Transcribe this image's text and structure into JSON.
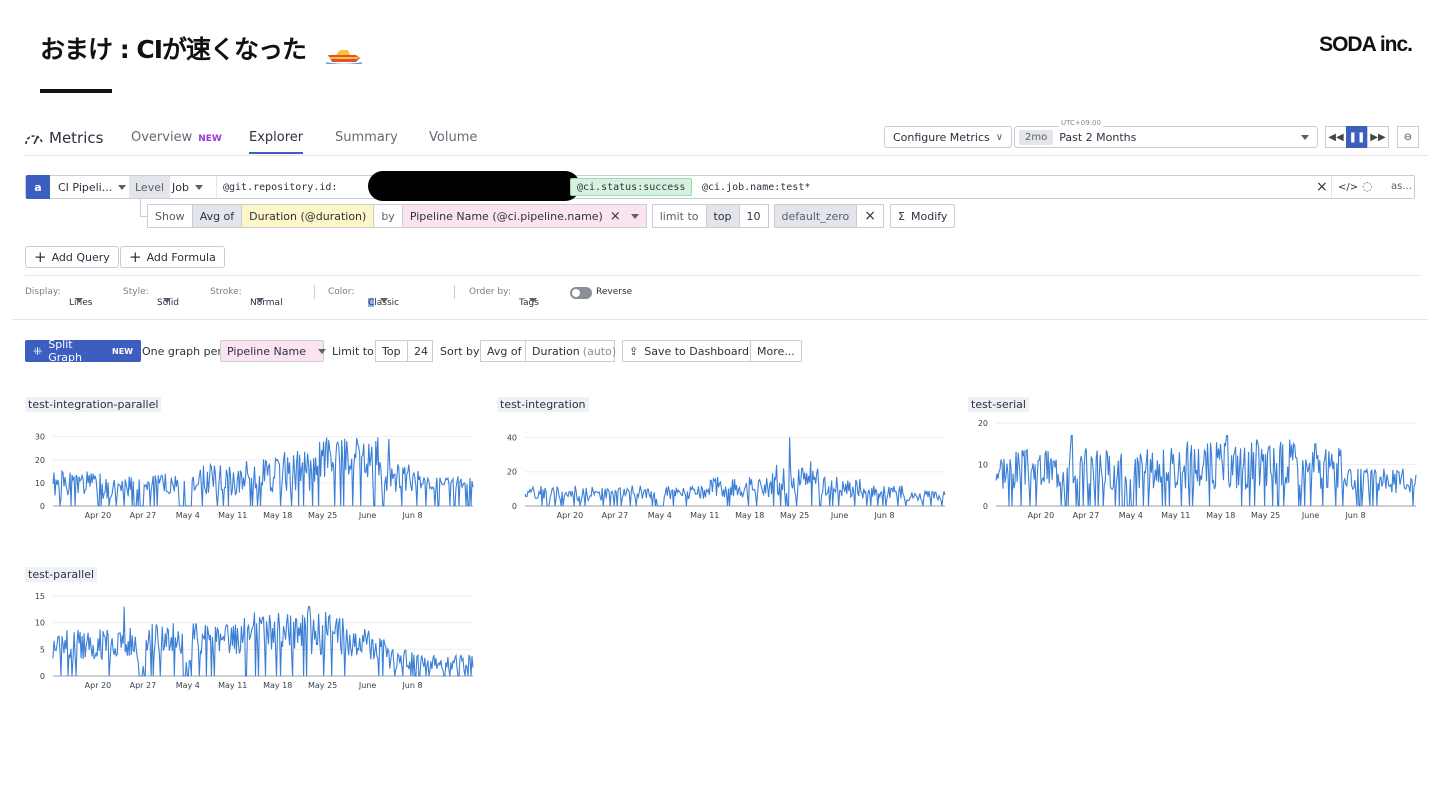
{
  "slide": {
    "title": "おまけ : CIが速くなった",
    "brand": "SODA inc.",
    "emoji_icon": "speedboat-icon"
  },
  "nav": {
    "product": "Metrics",
    "tabs": [
      {
        "label": "Overview",
        "badge": "NEW"
      },
      {
        "label": "Explorer",
        "active": true
      },
      {
        "label": "Summary"
      },
      {
        "label": "Volume"
      }
    ],
    "configure": "Configure Metrics",
    "timezone": "UTC+09:00",
    "range_pill": "2mo",
    "range_label": "Past 2 Months"
  },
  "query": {
    "letter": "a",
    "source": "CI Pipeli...",
    "level_label": "Level",
    "level_value": "Job",
    "filter_repo": "@git.repository.id:",
    "filter_status": "@ci.status:success",
    "filter_job": "@ci.job.name:test*",
    "alias": "as...",
    "show": "Show",
    "aggregation": "Avg of",
    "measure": "Duration (@duration)",
    "by": "by",
    "group": "Pipeline Name (@ci.pipeline.name)",
    "limit_label": "limit to",
    "limit_dir": "top",
    "limit_n": "10",
    "fill": "default_zero",
    "modify": "Modify"
  },
  "actions": {
    "add_query": "Add Query",
    "add_formula": "Add Formula"
  },
  "display": {
    "display_label": "Display:",
    "display_value": "Lines",
    "style_label": "Style:",
    "style_value": "Solid",
    "stroke_label": "Stroke:",
    "stroke_value": "Normal",
    "color_label": "Color:",
    "color_value": "Classic",
    "order_label": "Order by:",
    "order_value": "Tags",
    "reverse_label": "Reverse"
  },
  "split": {
    "button": "Split Graph",
    "badge": "NEW",
    "one_per": "One graph per",
    "per_value": "Pipeline Name",
    "limit_label": "Limit to",
    "limit_dir": "Top",
    "limit_n": "24",
    "sort_label": "Sort by",
    "sort_agg": "Avg of",
    "sort_measure": "Duration",
    "sort_hint": "(auto)",
    "save": "Save to Dashboard",
    "more": "More..."
  },
  "colors": {
    "accent": "#3c5fbf",
    "series": "#3a7fd5"
  },
  "chart_data": [
    {
      "type": "line",
      "title": "test-integration-parallel",
      "x_ticks": [
        "Apr 20",
        "Apr 27",
        "May 4",
        "May 11",
        "May 18",
        "May 25",
        "June",
        "Jun 8"
      ],
      "y_ticks": [
        0,
        10,
        20,
        30
      ],
      "ylim": [
        0,
        32
      ],
      "seed": 1,
      "segments": [
        [
          0.0,
          0.12,
          9,
          6
        ],
        [
          0.12,
          0.19,
          8,
          5
        ],
        [
          0.22,
          0.3,
          9,
          5
        ],
        [
          0.33,
          0.45,
          11,
          7
        ],
        [
          0.45,
          0.55,
          13,
          8
        ],
        [
          0.55,
          0.63,
          15,
          9
        ],
        [
          0.63,
          0.78,
          20,
          10
        ],
        [
          0.78,
          0.87,
          12,
          6
        ],
        [
          0.87,
          1.0,
          10,
          3
        ]
      ],
      "gaps": [
        [
          0.19,
          0.22
        ],
        [
          0.3,
          0.33
        ]
      ],
      "peaks": [
        [
          0.7,
          28
        ],
        [
          0.74,
          27
        ],
        [
          0.8,
          29
        ],
        [
          0.68,
          26
        ]
      ]
    },
    {
      "type": "line",
      "title": "test-integration",
      "x_ticks": [
        "Apr 20",
        "Apr 27",
        "May 4",
        "May 11",
        "May 18",
        "May 25",
        "June",
        "Jun 8"
      ],
      "y_ticks": [
        0,
        20,
        40
      ],
      "ylim": [
        0,
        42
      ],
      "seed": 2,
      "segments": [
        [
          0.0,
          0.12,
          8,
          4
        ],
        [
          0.12,
          0.2,
          7,
          4
        ],
        [
          0.22,
          0.31,
          8,
          4
        ],
        [
          0.33,
          0.44,
          8,
          4
        ],
        [
          0.44,
          0.58,
          11,
          6
        ],
        [
          0.58,
          0.7,
          14,
          8
        ],
        [
          0.7,
          0.8,
          11,
          6
        ],
        [
          0.8,
          0.9,
          8,
          4
        ],
        [
          0.9,
          1.0,
          6,
          3
        ]
      ],
      "gaps": [
        [
          0.2,
          0.22
        ],
        [
          0.31,
          0.33
        ]
      ],
      "peaks": [
        [
          0.63,
          40
        ],
        [
          0.68,
          26
        ],
        [
          0.6,
          24
        ],
        [
          0.66,
          22
        ]
      ]
    },
    {
      "type": "line",
      "title": "test-serial",
      "x_ticks": [
        "Apr 20",
        "Apr 27",
        "May 4",
        "May 11",
        "May 18",
        "May 25",
        "June",
        "Jun 8"
      ],
      "y_ticks": [
        0,
        10,
        20
      ],
      "ylim": [
        0,
        20
      ],
      "seed": 3,
      "segments": [
        [
          0.0,
          0.18,
          9,
          5
        ],
        [
          0.2,
          0.3,
          9,
          5
        ],
        [
          0.33,
          0.45,
          9,
          5
        ],
        [
          0.45,
          0.6,
          10,
          6
        ],
        [
          0.6,
          0.72,
          10,
          6
        ],
        [
          0.72,
          0.84,
          9,
          5
        ],
        [
          0.84,
          1.0,
          6,
          3
        ]
      ],
      "gaps": [
        [
          0.18,
          0.2
        ],
        [
          0.3,
          0.33
        ]
      ],
      "peaks": [
        [
          0.18,
          17
        ],
        [
          0.55,
          17
        ],
        [
          0.62,
          16
        ],
        [
          0.7,
          16
        ],
        [
          0.76,
          15
        ]
      ]
    },
    {
      "type": "line",
      "title": "test-parallel",
      "x_ticks": [
        "Apr 20",
        "Apr 27",
        "May 4",
        "May 11",
        "May 18",
        "May 25",
        "June",
        "Jun 8"
      ],
      "y_ticks": [
        0,
        5,
        10,
        15
      ],
      "ylim": [
        0,
        15
      ],
      "seed": 4,
      "segments": [
        [
          0.0,
          0.12,
          6,
          3
        ],
        [
          0.12,
          0.2,
          6,
          3
        ],
        [
          0.22,
          0.31,
          7,
          3
        ],
        [
          0.33,
          0.45,
          7,
          3
        ],
        [
          0.45,
          0.56,
          8,
          4
        ],
        [
          0.56,
          0.7,
          8,
          4
        ],
        [
          0.7,
          0.8,
          6,
          3
        ],
        [
          0.8,
          0.88,
          3,
          2
        ],
        [
          0.88,
          1.0,
          2.5,
          1.5
        ]
      ],
      "gaps": [
        [
          0.2,
          0.22
        ],
        [
          0.31,
          0.33
        ]
      ],
      "peaks": [
        [
          0.17,
          13
        ],
        [
          0.61,
          13
        ],
        [
          0.65,
          12
        ],
        [
          0.5,
          11
        ]
      ]
    }
  ]
}
